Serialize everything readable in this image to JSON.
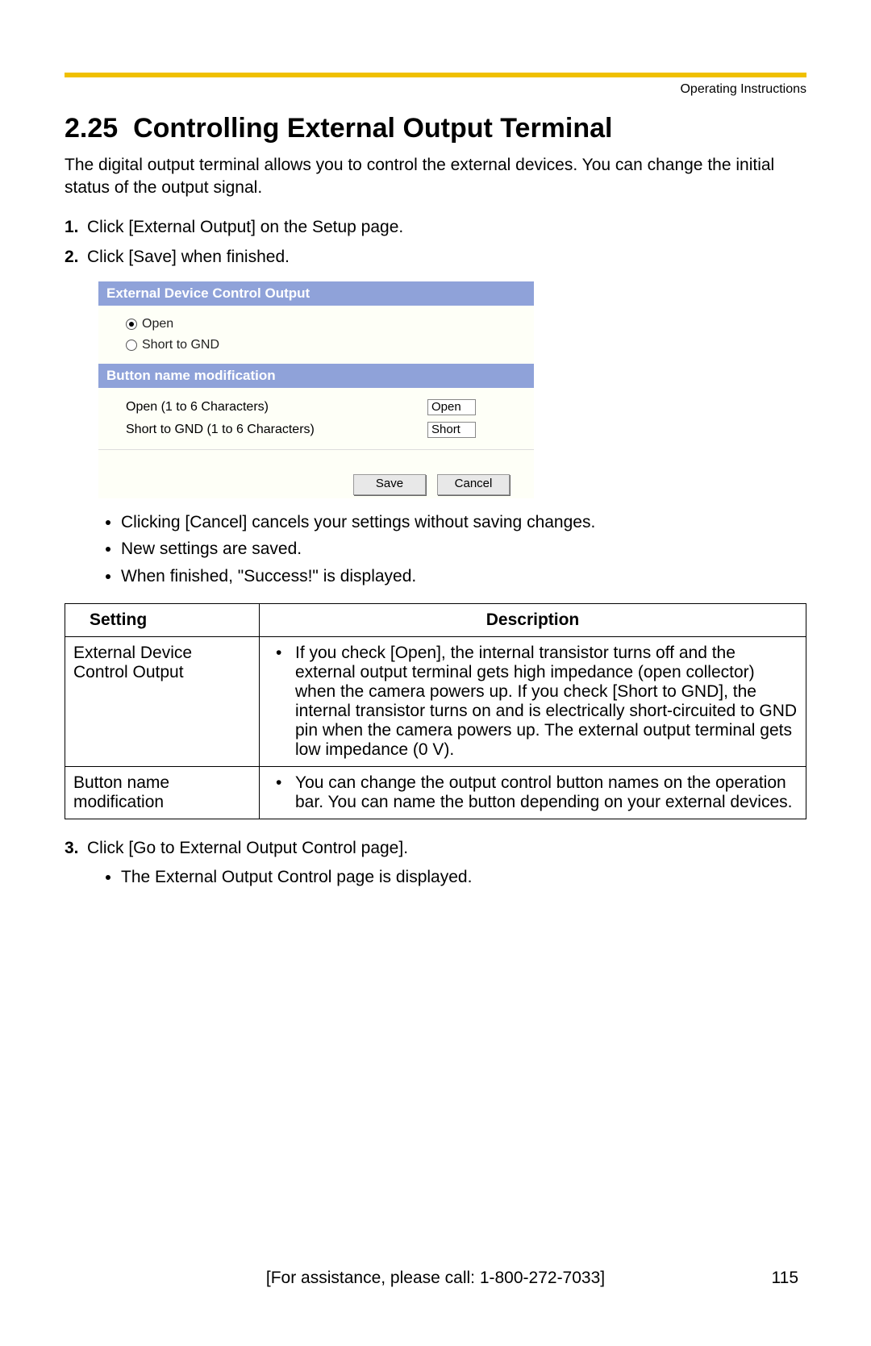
{
  "header": {
    "right": "Operating Instructions"
  },
  "section": {
    "number": "2.25",
    "title": "Controlling External Output Terminal",
    "intro": "The digital output terminal allows you to control the external devices. You can change the initial status of the output signal."
  },
  "steps": [
    "Click [External Output] on the Setup page.",
    "Click [Save] when finished."
  ],
  "ui": {
    "header1": "External Device Control Output",
    "radio_open": "Open",
    "radio_short": "Short to GND",
    "header2": "Button name modification",
    "field1_label": "Open (1 to 6 Characters)",
    "field1_value": "Open",
    "field2_label": "Short to GND (1 to 6 Characters)",
    "field2_value": "Short",
    "btn_save": "Save",
    "btn_cancel": "Cancel"
  },
  "notes": [
    "Clicking [Cancel] cancels your settings without saving changes.",
    "New settings are saved.",
    "When finished, \"Success!\" is displayed."
  ],
  "table": {
    "col1": "Setting",
    "col2": "Description",
    "rows": [
      {
        "setting": "External Device Control Output",
        "desc": "If you check [Open], the internal transistor turns off and the external output terminal gets high impedance (open collector) when the camera powers up. If you check [Short to GND], the internal transistor turns on and is electrically short-circuited to GND pin when the camera powers up. The external output terminal gets low impedance (0 V)."
      },
      {
        "setting": "Button name modification",
        "desc": "You can change the output control button names on the operation bar. You can name the button depending on your external devices."
      }
    ]
  },
  "step3": {
    "text": "Click [Go to External Output Control page].",
    "sub": "The External Output Control page is displayed."
  },
  "footer": {
    "assist": "[For assistance, please call: 1-800-272-7033]",
    "page": "115"
  }
}
